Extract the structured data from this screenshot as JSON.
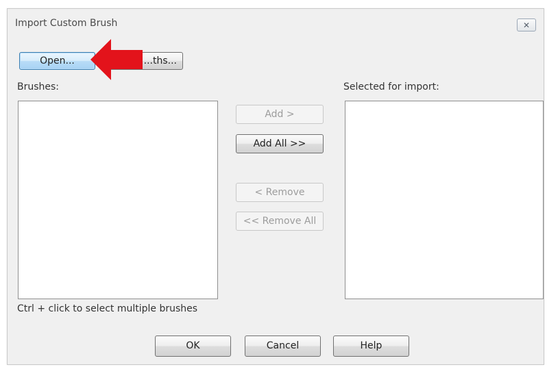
{
  "dialog": {
    "title": "Import Custom Brush",
    "close_icon": "close-icon",
    "buttons": {
      "open": "Open...",
      "paths": "...ths...",
      "add": "Add >",
      "add_all": "Add All >>",
      "remove": "< Remove",
      "remove_all": "<< Remove All",
      "ok": "OK",
      "cancel": "Cancel",
      "help": "Help"
    },
    "labels": {
      "brushes": "Brushes:",
      "selected": "Selected for import:",
      "hint": "Ctrl + click to select multiple brushes"
    },
    "lists": {
      "brushes": [],
      "selected": []
    }
  },
  "annotation": {
    "icon": "red-arrow-icon",
    "color": "#e3131b"
  }
}
